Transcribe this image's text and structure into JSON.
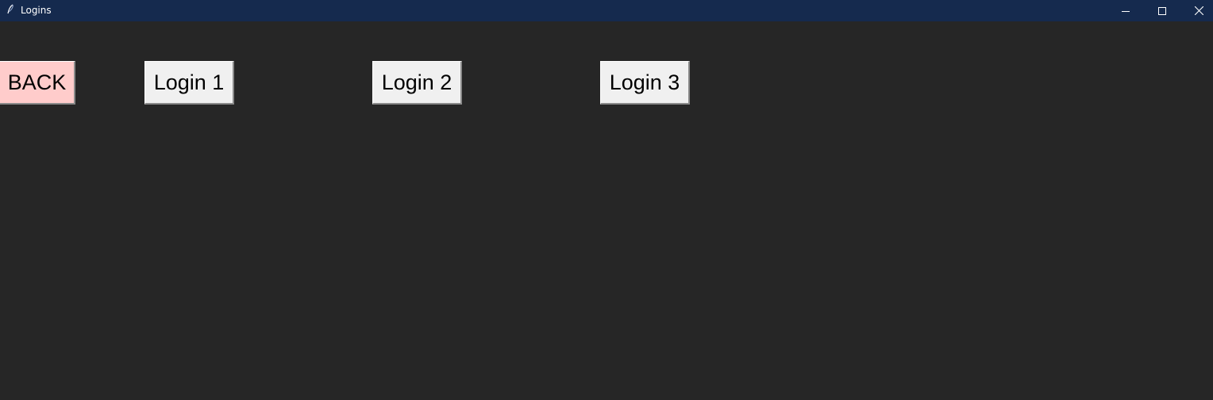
{
  "window": {
    "title": "Logins",
    "titlebar_color": "#152a4e",
    "background_color": "#262626",
    "controls": {
      "minimize_icon": "minimize-icon",
      "maximize_icon": "maximize-icon",
      "close_icon": "close-icon"
    }
  },
  "buttons": {
    "back": {
      "label": "BACK",
      "color": "#ffcccb"
    },
    "login1": {
      "label": "Login 1",
      "color": "#f0f0f0"
    },
    "login2": {
      "label": "Login 2",
      "color": "#f0f0f0"
    },
    "login3": {
      "label": "Login 3",
      "color": "#f0f0f0"
    }
  }
}
